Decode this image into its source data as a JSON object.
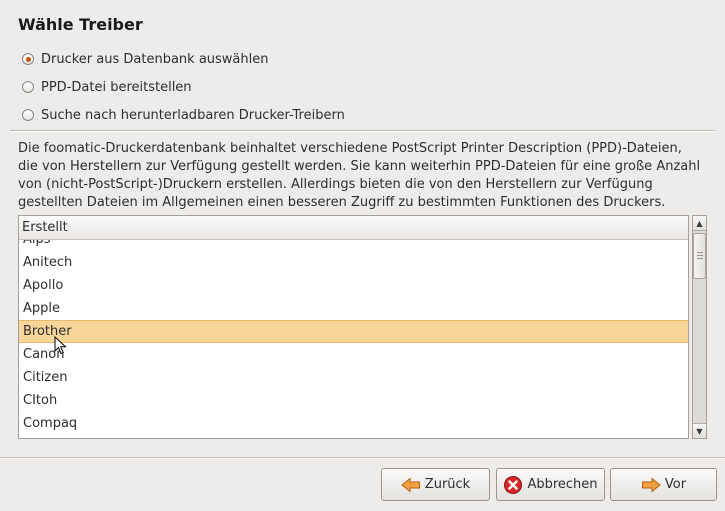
{
  "header": {
    "title": "Wähle Treiber"
  },
  "options": [
    {
      "label": "Drucker aus Datenbank auswählen",
      "checked": true
    },
    {
      "label": "PPD-Datei bereitstellen",
      "checked": false
    },
    {
      "label": "Suche nach herunterladbaren Drucker-Treibern",
      "checked": false
    }
  ],
  "description": {
    "lines": [
      "Die foomatic-Druckerdatenbank beinhaltet verschiedene PostScript Printer Description (PPD)-Dateien,",
      "die von Herstellern zur Verfügung gestellt werden. Sie kann weiterhin PPD-Dateien für eine große Anzahl",
      "von (nicht-PostScript-)Druckern erstellen. Allerdings bieten die von den Herstellern zur Verfügung",
      "gestellten Dateien im Allgemeinen einen besseren Zugriff zu bestimmten Funktionen des Druckers."
    ]
  },
  "list": {
    "header": "Erstellt",
    "items": [
      "Alps",
      "Anitech",
      "Apollo",
      "Apple",
      "Brother",
      "Canon",
      "Citizen",
      "CItoh",
      "Compaq"
    ],
    "selected": "Brother"
  },
  "buttons": {
    "back": {
      "label": "Zurück",
      "icon": "arrow-left-icon",
      "color": "#e8912d"
    },
    "cancel": {
      "label": "Abbrechen",
      "icon": "cancel-icon",
      "color": "#d62828"
    },
    "forward": {
      "label": "Vor",
      "icon": "arrow-right-icon",
      "color": "#e8912d"
    }
  }
}
